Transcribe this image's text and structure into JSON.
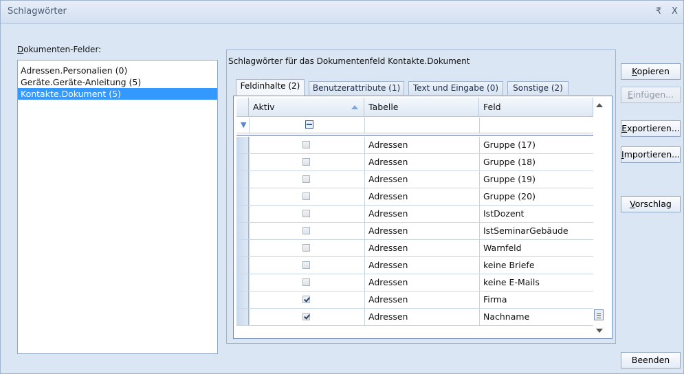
{
  "window": {
    "title": "Schlagwörter",
    "pin_glyph": "₹",
    "close_glyph": "X"
  },
  "left": {
    "label_prefix": "D",
    "label_rest": "okumenten-Felder:",
    "items": [
      {
        "label": "Adressen.Personalien (0)",
        "selected": false
      },
      {
        "label": "Geräte.Geräte-Anleitung (5)",
        "selected": false
      },
      {
        "label": "Kontakte.Dokument (5)",
        "selected": true
      }
    ]
  },
  "panel": {
    "heading": "Schlagwörter für das Dokumentenfeld Kontakte.Dokument",
    "tabs": [
      {
        "label": "Feldinhalte (2)",
        "active": true
      },
      {
        "label": "Benutzerattribute (1)",
        "active": false
      },
      {
        "label": "Text und Eingabe (0)",
        "active": false
      },
      {
        "label": "Sonstige (2)",
        "active": false
      }
    ]
  },
  "grid": {
    "columns": [
      "Aktiv",
      "Tabelle",
      "Feld"
    ],
    "rows": [
      {
        "aktiv": false,
        "tabelle": "Adressen",
        "feld": "Gruppe (17)"
      },
      {
        "aktiv": false,
        "tabelle": "Adressen",
        "feld": "Gruppe (18)"
      },
      {
        "aktiv": false,
        "tabelle": "Adressen",
        "feld": "Gruppe (19)"
      },
      {
        "aktiv": false,
        "tabelle": "Adressen",
        "feld": "Gruppe (20)"
      },
      {
        "aktiv": false,
        "tabelle": "Adressen",
        "feld": "IstDozent"
      },
      {
        "aktiv": false,
        "tabelle": "Adressen",
        "feld": "IstSeminarGebäude"
      },
      {
        "aktiv": false,
        "tabelle": "Adressen",
        "feld": "Warnfeld"
      },
      {
        "aktiv": false,
        "tabelle": "Adressen",
        "feld": "keine Briefe"
      },
      {
        "aktiv": false,
        "tabelle": "Adressen",
        "feld": "keine E-Mails"
      },
      {
        "aktiv": true,
        "tabelle": "Adressen",
        "feld": "Firma"
      },
      {
        "aktiv": true,
        "tabelle": "Adressen",
        "feld": "Nachname"
      }
    ]
  },
  "buttons": {
    "kopieren": {
      "first": "K",
      "rest": "opieren",
      "enabled": true
    },
    "einfuegen": {
      "first": "E",
      "rest": "infügen...",
      "enabled": false
    },
    "exportieren": {
      "first": "E",
      "rest": "xportieren...",
      "enabled": true
    },
    "importieren": {
      "first": "I",
      "rest": "mportieren...",
      "enabled": true
    },
    "vorschlag": {
      "first": "V",
      "rest": "orschlag",
      "enabled": true
    },
    "beenden": {
      "label": "Beenden",
      "enabled": true
    }
  }
}
